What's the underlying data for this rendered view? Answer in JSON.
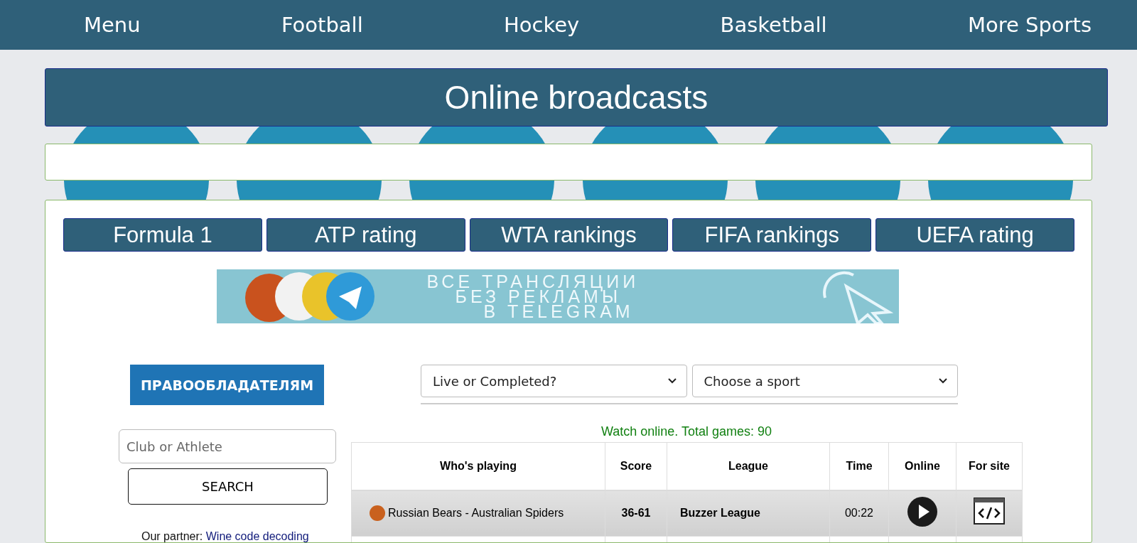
{
  "nav": [
    {
      "label": "Menu"
    },
    {
      "label": "Football"
    },
    {
      "label": "Hockey"
    },
    {
      "label": "Basketball"
    },
    {
      "label": "More Sports"
    }
  ],
  "title": "Online broadcasts",
  "ratings": [
    {
      "label": "Formula 1"
    },
    {
      "label": "ATP rating"
    },
    {
      "label": "WTA rankings"
    },
    {
      "label": "FIFA rankings"
    },
    {
      "label": "UEFA rating"
    }
  ],
  "telegram_banner": {
    "lines": [
      "ВСЕ ТРАНСЛЯЦИИ",
      "БЕЗ РЕКЛАМЫ",
      "В TELEGRAM"
    ]
  },
  "rights_banner": {
    "label": "ПРАВООБЛАДАТЕЛЯМ"
  },
  "search": {
    "placeholder": "Club or Athlete",
    "button": "SEARCH"
  },
  "partner": {
    "label": "Our partner:",
    "link": "Wine code decoding"
  },
  "filters": [
    {
      "value": "Live or Completed?"
    },
    {
      "value": "Choose a sport"
    }
  ],
  "summary": "Watch online. Total games: 90",
  "table": {
    "columns": [
      "Who's playing",
      "Score",
      "League",
      "Time",
      "Online",
      "For site"
    ],
    "rows": [
      {
        "kind": "basketball",
        "match": "Russian Bears - Australian Spiders",
        "score": "36-61",
        "league": "Buzzer League",
        "time": "00:22"
      }
    ]
  }
}
